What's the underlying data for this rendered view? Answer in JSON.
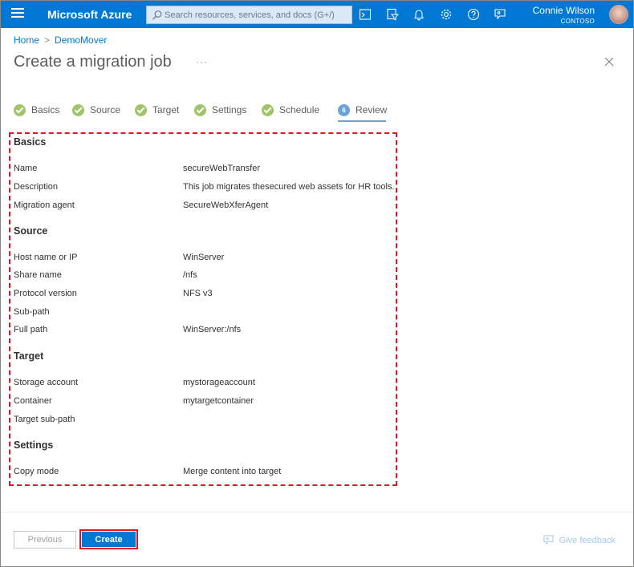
{
  "topbar": {
    "brand": "Microsoft Azure",
    "search_placeholder": "Search resources, services, and docs (G+/)",
    "user_name": "Connie Wilson",
    "user_org": "CONTOSO",
    "accent": "#0078d4"
  },
  "breadcrumb": {
    "home": "Home",
    "current": "DemoMover"
  },
  "page": {
    "title": "Create a migration job",
    "more": "···"
  },
  "steps": [
    {
      "label": "Basics",
      "state": "done"
    },
    {
      "label": "Source",
      "state": "done"
    },
    {
      "label": "Target",
      "state": "done"
    },
    {
      "label": "Settings",
      "state": "done"
    },
    {
      "label": "Schedule",
      "state": "done"
    },
    {
      "label": "Review",
      "state": "active",
      "number": "6"
    }
  ],
  "review": {
    "basics": {
      "heading": "Basics",
      "rows": [
        {
          "label": "Name",
          "value": "secureWebTransfer"
        },
        {
          "label": "Description",
          "value": "This job migrates thesecured web assets for HR tools."
        },
        {
          "label": "Migration agent",
          "value": "SecureWebXferAgent"
        }
      ]
    },
    "source": {
      "heading": "Source",
      "rows": [
        {
          "label": "Host name or IP",
          "value": "WinServer"
        },
        {
          "label": "Share name",
          "value": "/nfs"
        },
        {
          "label": "Protocol version",
          "value": "NFS v3"
        },
        {
          "label": "Sub-path",
          "value": ""
        },
        {
          "label": "Full path",
          "value": "WinServer:/nfs"
        }
      ]
    },
    "target": {
      "heading": "Target",
      "rows": [
        {
          "label": "Storage account",
          "value": "mystorageaccount"
        },
        {
          "label": "Container",
          "value": "mytargetcontainer"
        },
        {
          "label": "Target sub-path",
          "value": ""
        }
      ]
    },
    "settings": {
      "heading": "Settings",
      "rows": [
        {
          "label": "Copy mode",
          "value": "Merge content into target"
        }
      ]
    }
  },
  "footer": {
    "previous_label": "Previous",
    "create_label": "Create",
    "feedback_label": "Give feedback"
  }
}
